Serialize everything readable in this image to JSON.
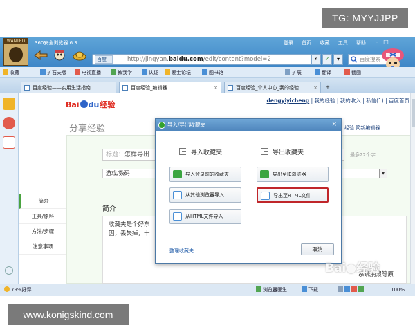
{
  "watermarks": {
    "telegram": "TG: MYYJJPP",
    "site": "www.konigskind.com",
    "baidu": "Bai●经验"
  },
  "titlebar": {
    "app_title": "360安全浏览器 6.3",
    "avatar_label": "WANTED",
    "links": [
      "登录",
      "首页",
      "收藏",
      "工具",
      "帮助"
    ],
    "site_tag": "百度",
    "url_prefix": "http://jingyan.",
    "url_domain": "baidu.com",
    "url_path": "/edit/content?model=2",
    "search_placeholder": "百度搜索"
  },
  "favorites": {
    "items": [
      "收藏",
      "扩石夫版",
      "电视直播",
      "教我学",
      "认证",
      "爱士论坛",
      "图书馆",
      "扩展",
      "翻译",
      "截图"
    ]
  },
  "tabs": [
    {
      "label": "百度经验——实用生活指南",
      "active": false
    },
    {
      "label": "百度经验_编辑器",
      "active": true
    },
    {
      "label": "百度经验_个人中心_我的经验",
      "active": false
    }
  ],
  "page": {
    "username": "dengyiyicheng",
    "user_links": "| 我的经验 | 我的收入 | 私信(1) | 百度首页",
    "logo_bai": "Bai",
    "logo_du": "du",
    "logo_jy": "经验",
    "heading": "分享经验",
    "right_tabs": "经验    简新编辑器",
    "title_label": "标题：",
    "title_value": "怎样导出",
    "char_limit": "最多22个字",
    "category": "游戏/数码",
    "left_nav": [
      "简介",
      "工具/原料",
      "方法/步骤",
      "注意事项"
    ],
    "intro_heading": "简介",
    "intro_line1": "收藏夹是个好东",
    "intro_line2": "因，丢失掉，十",
    "intro_tail": "系统崩溃等原"
  },
  "dialog": {
    "title": "导入/导出收藏夹",
    "close": "×",
    "import_heading": "导入收藏夹",
    "export_heading": "导出收藏夹",
    "import_buttons": [
      "导入登录前的收藏夹",
      "从其他浏览器导入",
      "从HTML文件导入"
    ],
    "export_buttons": [
      "导出至IE浏览器",
      "导出至HTML文件"
    ],
    "organize_link": "整理收藏夹",
    "cancel": "取消"
  },
  "statusbar": {
    "left": "79%好评",
    "browser_doctor": "浏览器医生",
    "download": "下载",
    "zoom": "100%"
  },
  "colors": {
    "titlebar": "#4a92cf",
    "highlight_box": "#c0262a",
    "brand_red": "#e02e24",
    "brand_blue": "#2d63c8"
  }
}
